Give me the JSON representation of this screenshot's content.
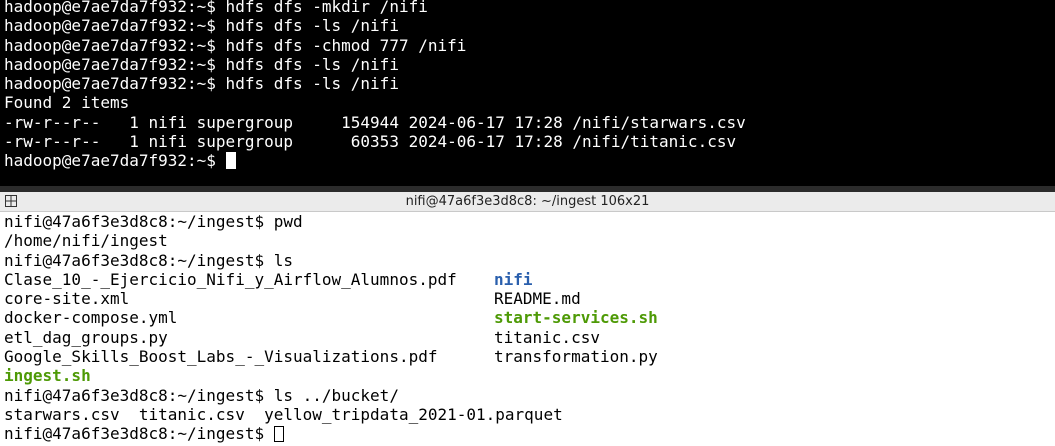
{
  "top_terminal": {
    "lines": [
      "hadoop@e7ae7da7f932:~$ hdfs dfs -mkdir /nifi",
      "hadoop@e7ae7da7f932:~$ hdfs dfs -ls /nifi",
      "hadoop@e7ae7da7f932:~$ hdfs dfs -chmod 777 /nifi",
      "hadoop@e7ae7da7f932:~$ hdfs dfs -ls /nifi",
      "hadoop@e7ae7da7f932:~$ hdfs dfs -ls /nifi",
      "Found 2 items",
      "-rw-r--r--   1 nifi supergroup     154944 2024-06-17 17:28 /nifi/starwars.csv",
      "-rw-r--r--   1 nifi supergroup      60353 2024-06-17 17:28 /nifi/titanic.csv"
    ],
    "prompt": "hadoop@e7ae7da7f932:~$ "
  },
  "window_title": "nifi@47a6f3e3d8c8: ~/ingest 106x21",
  "bottom_terminal": {
    "line_pwd_cmd": "nifi@47a6f3e3d8c8:~/ingest$ pwd",
    "line_pwd_out": "/home/nifi/ingest",
    "line_ls_cmd": "nifi@47a6f3e3d8c8:~/ingest$ ls",
    "ls_rows": [
      {
        "left": "Clase_10_-_Ejercicio_Nifi_y_Airflow_Alumnos.pdf",
        "right": "nifi"
      },
      {
        "left": "core-site.xml",
        "right": "README.md"
      },
      {
        "left": "docker-compose.yml",
        "right": "start-services.sh"
      },
      {
        "left": "etl_dag_groups.py",
        "right": "titanic.csv"
      },
      {
        "left": "Google_Skills_Boost_Labs_-_Visualizations.pdf",
        "right": "transformation.py"
      }
    ],
    "ls_last": "ingest.sh",
    "line_ls_bucket_cmd": "nifi@47a6f3e3d8c8:~/ingest$ ls ../bucket/",
    "line_ls_bucket_out": "starwars.csv  titanic.csv  yellow_tripdata_2021-01.parquet",
    "prompt": "nifi@47a6f3e3d8c8:~/ingest$ "
  },
  "colors": {
    "directory": "#2a5fad",
    "executable": "#4e9a06",
    "top_bg": "#000000",
    "bottom_bg": "#ffffff"
  }
}
